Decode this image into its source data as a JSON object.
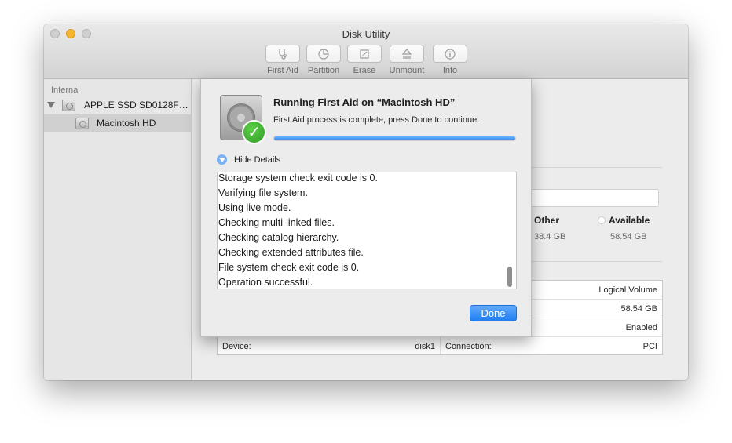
{
  "window": {
    "title": "Disk Utility"
  },
  "toolbar": [
    {
      "label": "First Aid",
      "icon": "stethoscope-icon"
    },
    {
      "label": "Partition",
      "icon": "pie-icon"
    },
    {
      "label": "Erase",
      "icon": "erase-icon"
    },
    {
      "label": "Unmount",
      "icon": "eject-icon"
    },
    {
      "label": "Info",
      "icon": "info-icon"
    }
  ],
  "sidebar": {
    "section": "Internal",
    "disk": "APPLE SSD SD0128F…",
    "volume": "Macintosh HD"
  },
  "usage": {
    "other_label": "Other",
    "other_value": "38.4 GB",
    "available_label": "Available",
    "available_value": "58.54 GB"
  },
  "info_table": {
    "rows": [
      {
        "right_value": "Logical Volume"
      },
      {
        "right_value": "58.54 GB"
      },
      {
        "right_value": "Enabled"
      },
      {
        "left_label": "Device:",
        "left_value": "disk1",
        "right_label": "Connection:",
        "right_value": "PCI"
      }
    ]
  },
  "sheet": {
    "title": "Running First Aid on “Macintosh HD”",
    "message": "First Aid process is complete, press Done to continue.",
    "progress_percent": 100,
    "hide_details": "Hide Details",
    "log": [
      "Storage system check exit code is 0.",
      "Verifying file system.",
      "Using live mode.",
      "Checking multi-linked files.",
      "Checking catalog hierarchy.",
      "Checking extended attributes file.",
      "File system check exit code is 0.",
      "Operation successful."
    ],
    "done": "Done"
  },
  "colors": {
    "accent": "#2f86f0",
    "success": "#2d9a22"
  }
}
